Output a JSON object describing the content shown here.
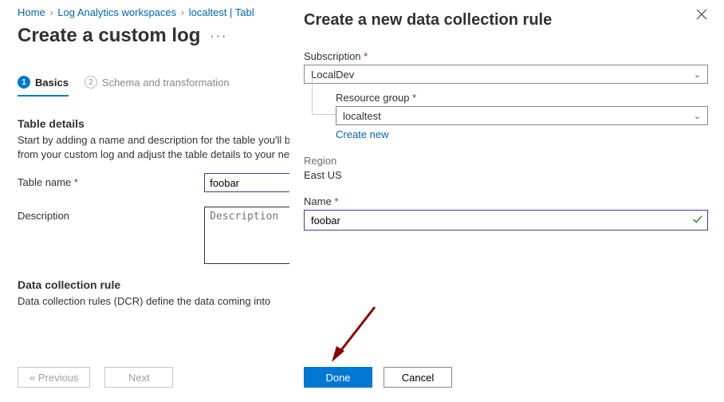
{
  "breadcrumb": {
    "home": "Home",
    "ws": "Log Analytics workspaces",
    "inst": "localtest | Tabl"
  },
  "page": {
    "title": "Create a custom log"
  },
  "tabs": {
    "basics": "Basics",
    "schema": "Schema and transformation"
  },
  "details": {
    "heading": "Table details",
    "text": "Start by adding a name and description for the table you'll be creating to store the data from your custom log and adjust the table details to your needs.",
    "tableNameLabel": "Table name",
    "tableNameValue": "foobar",
    "descLabel": "Description",
    "descPh": "Description"
  },
  "dcr": {
    "heading": "Data collection rule",
    "text": "Data collection rules (DCR) define the data coming into"
  },
  "nav": {
    "prev": "« Previous",
    "next": "Next"
  },
  "panel": {
    "title": "Create a new data collection rule",
    "subLabel": "Subscription",
    "subValue": "LocalDev",
    "rgLabel": "Resource group",
    "rgValue": "localtest",
    "createNew": "Create new",
    "regionLabel": "Region",
    "regionValue": "East US",
    "nameLabel": "Name",
    "nameValue": "foobar",
    "done": "Done",
    "cancel": "Cancel"
  }
}
